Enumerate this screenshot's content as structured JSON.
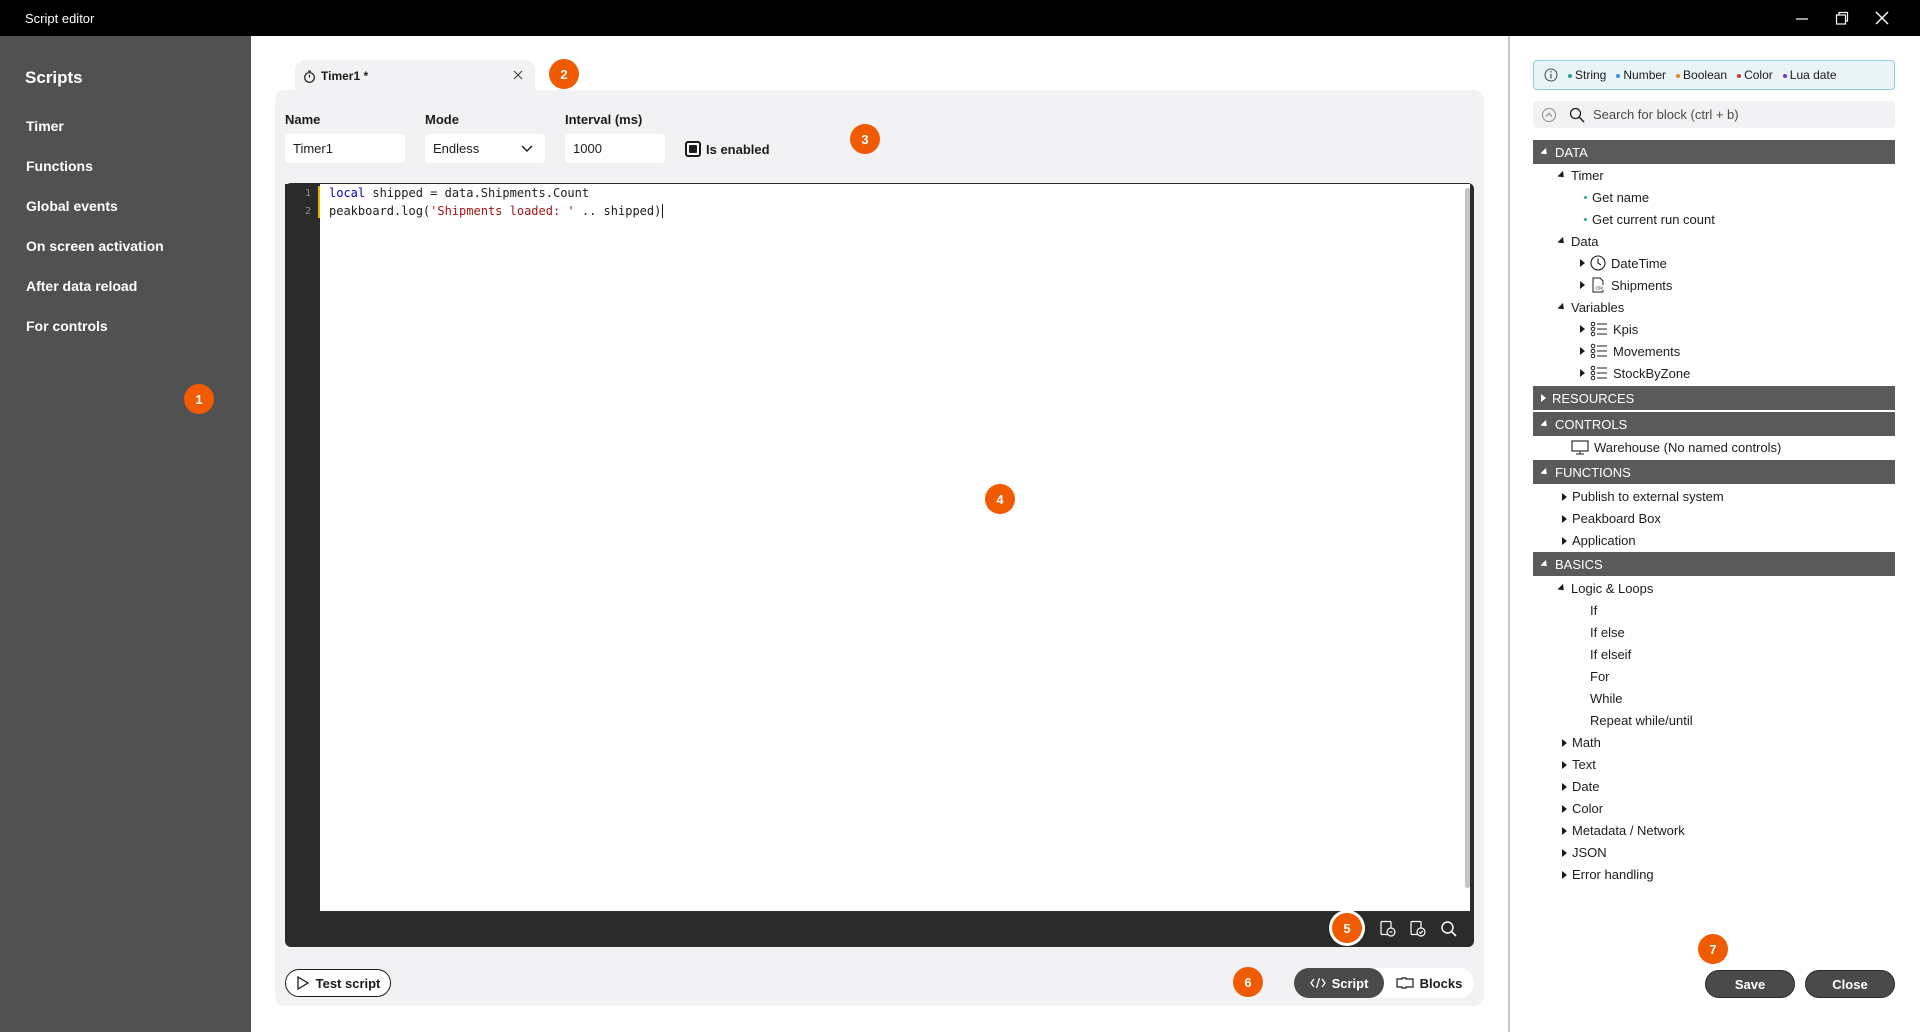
{
  "window": {
    "title": "Script editor"
  },
  "sidebar": {
    "heading": "Scripts",
    "items": [
      {
        "label": "Timer"
      },
      {
        "label": "Functions"
      },
      {
        "label": "Global events"
      },
      {
        "label": "On screen activation"
      },
      {
        "label": "After data reload"
      },
      {
        "label": "For controls"
      }
    ]
  },
  "tab": {
    "label": "Timer1 *"
  },
  "form": {
    "name_label": "Name",
    "name_value": "Timer1",
    "mode_label": "Mode",
    "mode_value": "Endless",
    "interval_label": "Interval (ms)",
    "interval_value": "1000",
    "enabled_label": "Is enabled"
  },
  "editor": {
    "line_numbers": [
      "1",
      "2"
    ],
    "line1": {
      "kw": "local",
      "rest": " shipped = data.Shipments.Count"
    },
    "line2": {
      "pre": "peakboard.log(",
      "str": "'Shipments loaded: '",
      "post": " .. shipped)"
    }
  },
  "footer": {
    "test_label": "Test script",
    "script_label": "Script",
    "blocks_label": "Blocks"
  },
  "legend": {
    "items": [
      {
        "label": "String",
        "color": "#2aa198"
      },
      {
        "label": "Number",
        "color": "#3b8ed8"
      },
      {
        "label": "Boolean",
        "color": "#e08a1e"
      },
      {
        "label": "Color",
        "color": "#d0362f"
      },
      {
        "label": "Lua date",
        "color": "#6a3cc8"
      }
    ]
  },
  "search": {
    "placeholder": "Search for block (ctrl + b)"
  },
  "tree": {
    "data": "DATA",
    "timer": "Timer",
    "get_name": "Get name",
    "get_run_count": "Get current run count",
    "data_node": "Data",
    "datetime": "DateTime",
    "shipments": "Shipments",
    "variables": "Variables",
    "kpis": "Kpis",
    "movements": "Movements",
    "stock": "StockByZone",
    "resources": "RESOURCES",
    "controls": "CONTROLS",
    "warehouse": "Warehouse (No named controls)",
    "functions": "FUNCTIONS",
    "publish": "Publish to external system",
    "box": "Peakboard Box",
    "application": "Application",
    "basics": "BASICS",
    "logic": "Logic & Loops",
    "if": "If",
    "ifelse": "If else",
    "ifelseif": "If elseif",
    "for": "For",
    "while": "While",
    "repeat": "Repeat while/until",
    "math": "Math",
    "text": "Text",
    "date": "Date",
    "color": "Color",
    "metadata": "Metadata / Network",
    "json": "JSON",
    "error": "Error handling"
  },
  "actions": {
    "save": "Save",
    "close": "Close"
  },
  "markers": [
    "1",
    "2",
    "3",
    "4",
    "5",
    "6",
    "7"
  ],
  "colors": {
    "accent": "#f05a00",
    "sidebar": "#515151",
    "section": "#5a5a5a"
  }
}
